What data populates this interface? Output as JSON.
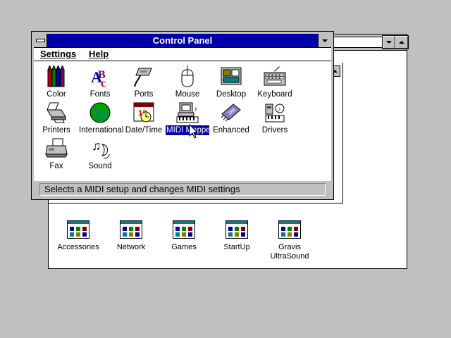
{
  "control_panel": {
    "title": "Control Panel",
    "menu": [
      {
        "label": "Settings"
      },
      {
        "label": "Help"
      }
    ],
    "icons": [
      {
        "label": "Color",
        "icon": "color-crayons-icon"
      },
      {
        "label": "Fonts",
        "icon": "fonts-icon"
      },
      {
        "label": "Ports",
        "icon": "ports-icon"
      },
      {
        "label": "Mouse",
        "icon": "mouse-icon"
      },
      {
        "label": "Desktop",
        "icon": "desktop-icon"
      },
      {
        "label": "Keyboard",
        "icon": "keyboard-icon"
      },
      {
        "label": "Printers",
        "icon": "printer-icon"
      },
      {
        "label": "International",
        "icon": "globe-icon"
      },
      {
        "label": "Date/Time",
        "icon": "calendar-clock-icon"
      },
      {
        "label": "MIDI Mapper",
        "icon": "midi-mapper-icon",
        "selected": true
      },
      {
        "label": "Enhanced",
        "icon": "chip-icon"
      },
      {
        "label": "Drivers",
        "icon": "drivers-icon"
      },
      {
        "label": "Fax",
        "icon": "fax-icon"
      },
      {
        "label": "Sound",
        "icon": "sound-icon"
      }
    ],
    "status_text": "Selects a MIDI setup and changes MIDI settings"
  },
  "program_groups": [
    {
      "label": "Accessories"
    },
    {
      "label": "Network"
    },
    {
      "label": "Games"
    },
    {
      "label": "StartUp"
    },
    {
      "label": "Gravis UltraSound"
    }
  ],
  "colors": {
    "titlebar_active": "#0000a8",
    "desktop": "#c0c0c0",
    "selection": "#0000a8"
  }
}
